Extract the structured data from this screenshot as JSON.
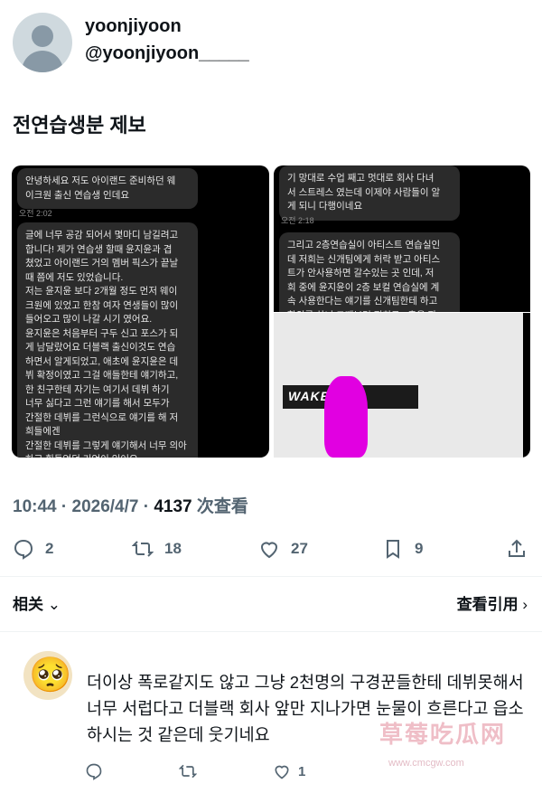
{
  "author": {
    "name": "yoonjiyoon",
    "handle": "@yoonjiyoon_____"
  },
  "tweet_text": "전연습생분 제보",
  "screenshot_left": {
    "bubble1": "안녕하세요 저도 아이랜드 준비하던 웨\n이크원 출신 연습생 인데요",
    "time1": "오전 2:02",
    "bubble2": "글에 너무 공감 되어서 몇마디 남길려고\n합니다! 제가 연습생 할때 윤지윤과 겹\n쳤었고 아이랜드 거의 멤버 픽스가 끝날\n때 쯤에 저도 있었습니다.\n저는 윤지윤 보다 2개월 정도 먼저 웨이\n크원에 있었고 한참 여자 연생들이 많이\n들어오고 많이 나갈 시기 였어요.\n윤지윤은 처음부터 구두 신고 포스가 되\n게 남달랐어요 더블랙 출신이것도 연습\n하면서 알게되었고, 애초에 윤지윤은 데\n뷔 확정이였고 그걸 애들한테 얘기하고,\n한 친구한테 자기는 여기서 데뷔 하기\n너무 싫다고 그런 얘기를 해서 모두가\n간절한 데뷔를 그런식으로 얘기를 해 저\n희들에겐\n간절한 데뷔를 그렇게 얘기해서 너무 의아\n하고 힘들었던 기억이 있어요"
  },
  "screenshot_right": {
    "bubble1": "기 망대로 수업 째고 멋대로 회사 다녀\n서 스트레스 였는데 이제야 사람들이 알\n게 되니 다행이네요",
    "time1": "오전 2:18",
    "bubble2": "그리고 2층연습실이 아티스트 연습실인\n데 저희는 신개팀에게 허락 받고 아티스\n트가 안사용하면 갈수있는 곳 인데, 저\n희 중에 윤지윤이 2층 보컬 연습실에 계\n속 사용한다는 얘기를 신개팀한테 하고\n할의를 하니 그때부터 저희도 2층을 자",
    "sign_text": "WAKEON"
  },
  "meta": {
    "time": "10:44",
    "date": "2026/4/7",
    "views": "4137",
    "views_label": "次查看"
  },
  "actions": {
    "replies": "2",
    "retweets": "18",
    "likes": "27",
    "bookmarks": "9"
  },
  "related": {
    "label": "相关",
    "quotes_label": "查看引用"
  },
  "reply": {
    "emoji": "🥺",
    "text": "더이상 폭로같지도 않고 그냥 2천명의 구경꾼들한테 데뷔못해서 너무 서럽다고 더블랙 회사 앞만 지나가면 눈물이 흐른다고 읍소하시는 것 같은데 웃기네요",
    "likes": "1"
  },
  "watermark": {
    "main": "草莓吃瓜网",
    "sub": "www.cmcgw.com"
  }
}
